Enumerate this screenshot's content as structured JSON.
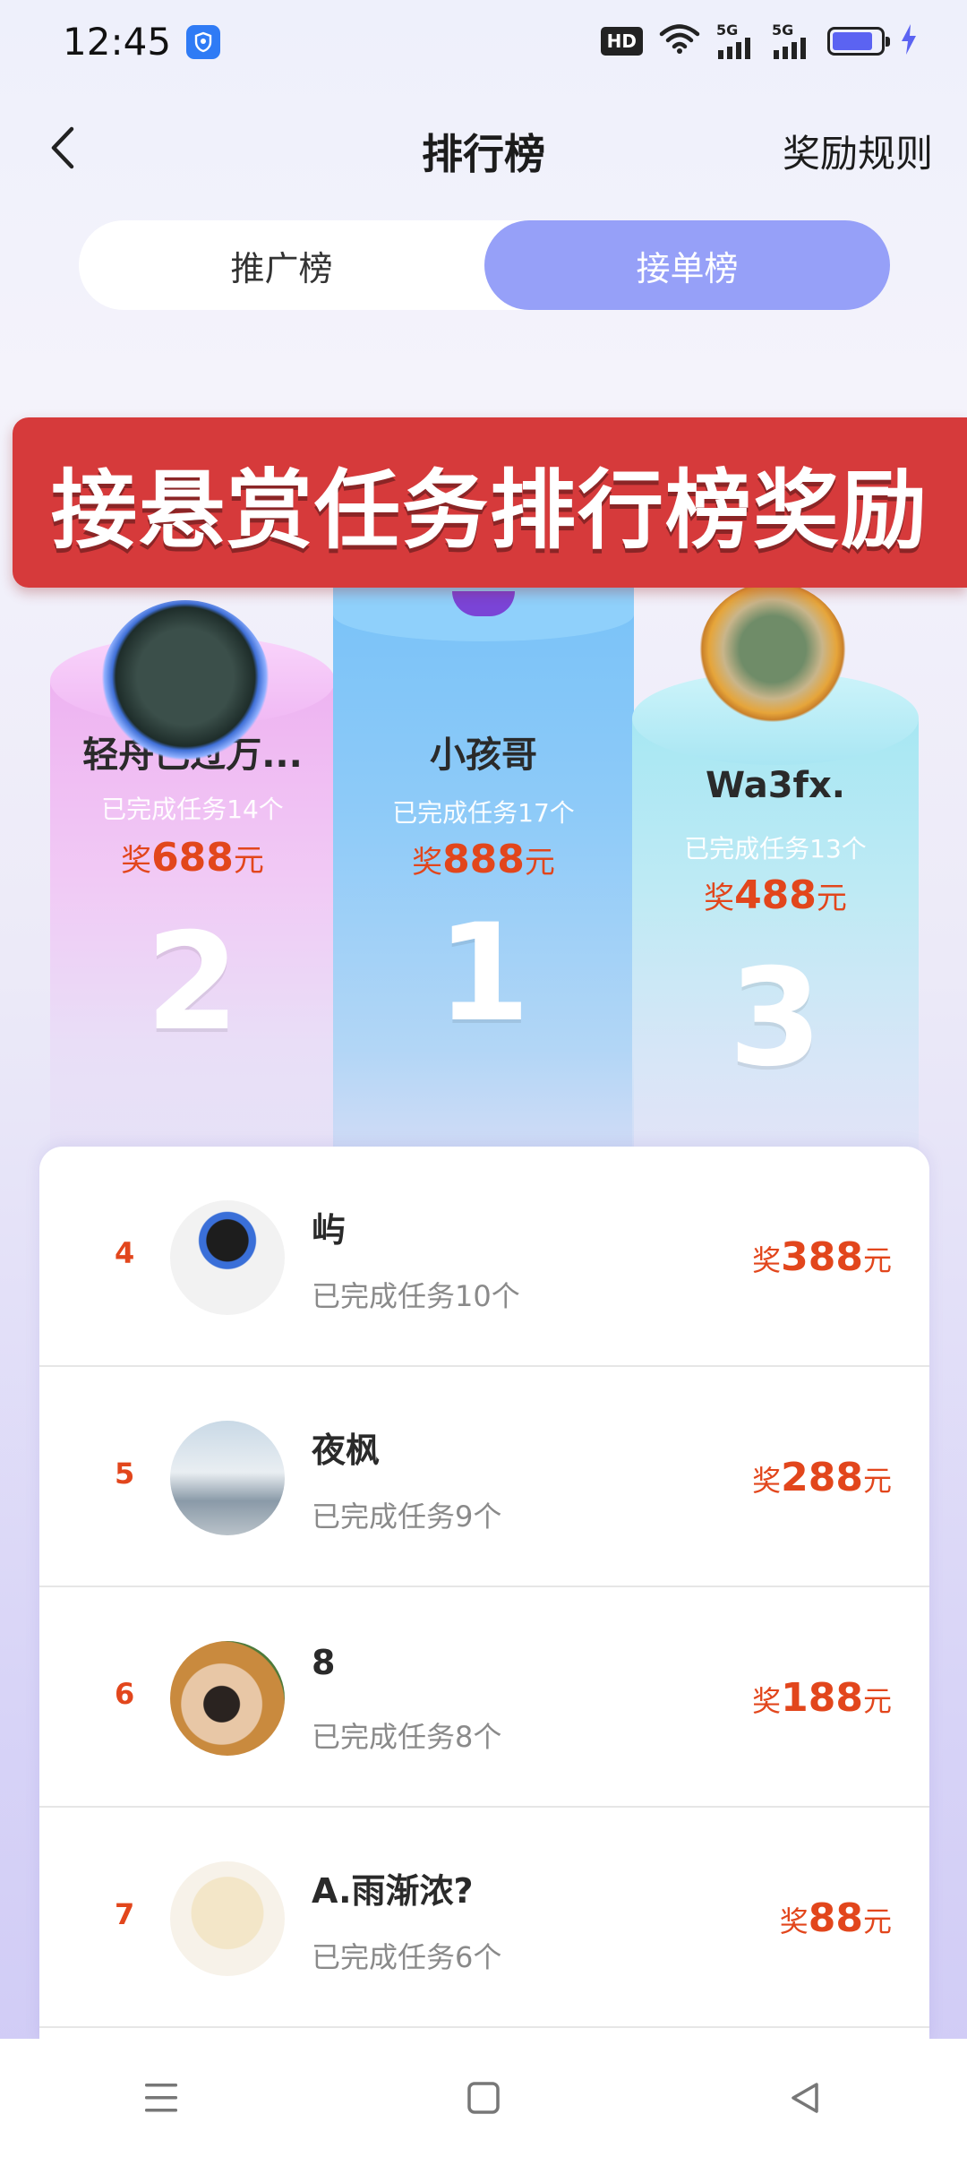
{
  "status_bar": {
    "time": "12:45",
    "hd_label": "HD",
    "net1": "5G",
    "net2": "5G",
    "battery_level": 0.85,
    "accent": "#5b63f2"
  },
  "header": {
    "title": "排行榜",
    "rules_link": "奖励规则",
    "back_icon": "chevron-left-icon"
  },
  "tabs": [
    {
      "label": "推广榜",
      "active": false
    },
    {
      "label": "接单榜",
      "active": true
    }
  ],
  "banner": {
    "text": "接悬赏任务排行榜奖励"
  },
  "podium": [
    {
      "rank": "2",
      "name": "轻舟已过万...",
      "tasks": "已完成任务14个",
      "reward_prefix": "奖",
      "reward_amount": "688",
      "reward_suffix": "元"
    },
    {
      "rank": "1",
      "name": "小孩哥",
      "tasks": "已完成任务17个",
      "reward_prefix": "奖",
      "reward_amount": "888",
      "reward_suffix": "元"
    },
    {
      "rank": "3",
      "name": "Wa3fx.",
      "tasks": "已完成任务13个",
      "reward_prefix": "奖",
      "reward_amount": "488",
      "reward_suffix": "元"
    }
  ],
  "ranking": [
    {
      "rank": "4",
      "name": "屿",
      "tasks": "已完成任务10个",
      "reward_prefix": "奖",
      "reward_amount": "388",
      "reward_suffix": "元"
    },
    {
      "rank": "5",
      "name": "夜枫",
      "tasks": "已完成任务9个",
      "reward_prefix": "奖",
      "reward_amount": "288",
      "reward_suffix": "元"
    },
    {
      "rank": "6",
      "name": "8",
      "tasks": "已完成任务8个",
      "reward_prefix": "奖",
      "reward_amount": "188",
      "reward_suffix": "元"
    },
    {
      "rank": "7",
      "name": "A.雨渐浓?",
      "tasks": "已完成任务6个",
      "reward_prefix": "奖",
      "reward_amount": "88",
      "reward_suffix": "元"
    }
  ],
  "colors": {
    "reward": "#e2461c",
    "active_tab": "#96a0f8",
    "banner": "#d63a3b"
  },
  "nav": {
    "menu_icon": "menu-icon",
    "home_icon": "square-home-icon",
    "back_icon": "triangle-back-icon"
  }
}
